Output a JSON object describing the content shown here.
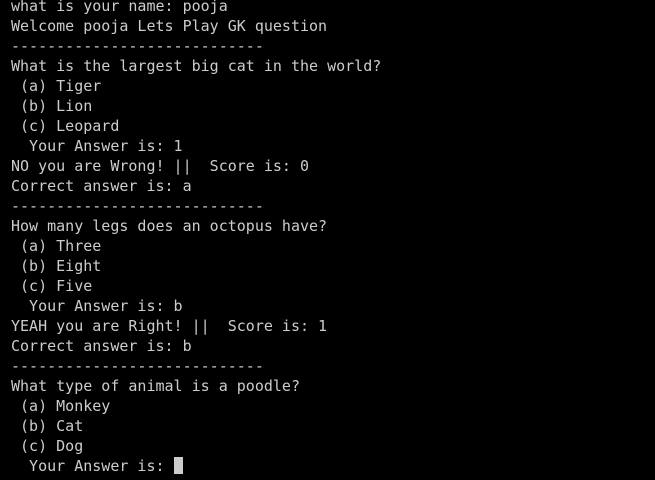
{
  "terminal": {
    "lines": [
      "what is your name: pooja",
      "Welcome pooja Lets Play GK question",
      "----------------------------",
      "What is the largest big cat in the world?",
      " (a) Tiger",
      " (b) Lion",
      " (c) Leopard",
      "  Your Answer is: 1",
      "NO you are Wrong! ||  Score is: 0",
      "Correct answer is: a",
      "----------------------------",
      "How many legs does an octopus have?",
      " (a) Three",
      " (b) Eight",
      " (c) Five",
      "  Your Answer is: b",
      "YEAH you are Right! ||  Score is: 1",
      "Correct answer is: b",
      "----------------------------",
      "What type of animal is a poodle?",
      " (a) Monkey",
      " (b) Cat",
      " (c) Dog"
    ],
    "prompt": "  Your Answer is: ",
    "colors": {
      "background": "#000000",
      "foreground": "#cccccc"
    }
  }
}
